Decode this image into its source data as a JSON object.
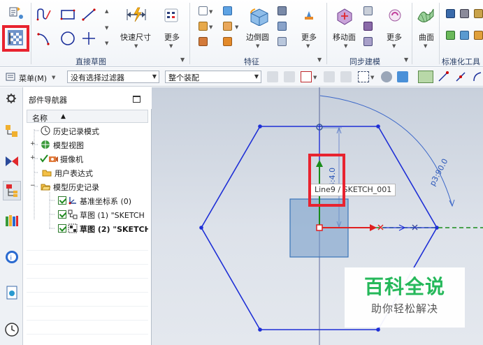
{
  "ribbon": {
    "quick_dim_label": "快速尺寸",
    "more_label": "更多",
    "edge_blend_label": "边倒圆",
    "move_face_label": "移动面",
    "surface_label": "曲面",
    "groups": {
      "direct_sketch": "直接草图",
      "feature": "特征",
      "sync_model": "同步建模",
      "standard_tools": "标准化工具 -"
    }
  },
  "filter_bar": {
    "menu_label": "菜单(M)",
    "filter_value": "没有选择过滤器",
    "assembly_value": "整个装配"
  },
  "navigator": {
    "title": "部件导航器",
    "column_name": "名称",
    "sort_glyph": "▲",
    "items": [
      {
        "label": "历史记录模式"
      },
      {
        "label": "模型视图"
      },
      {
        "label": "摄像机"
      },
      {
        "label": "用户表达式"
      },
      {
        "label": "模型历史记录"
      },
      {
        "label": "基准坐标系 (0)"
      },
      {
        "label": "草图 (1) \"SKETCH"
      },
      {
        "label": "草图 (2) \"SKETCH"
      }
    ]
  },
  "viewport": {
    "tooltip": "Line9 / SKETCH_001",
    "dim_vertical": "p4:4.0",
    "dim_angle": "p3:90.0"
  },
  "watermark": {
    "main": "百科全说",
    "sub": "助你轻松解决"
  },
  "colors": {
    "highlight": "#e8232f",
    "sketch_blue": "#1e2fd6",
    "axis_red": "#e02020",
    "axis_green": "#1a8c1a",
    "ribbon_group_label": "#2a3f66"
  }
}
